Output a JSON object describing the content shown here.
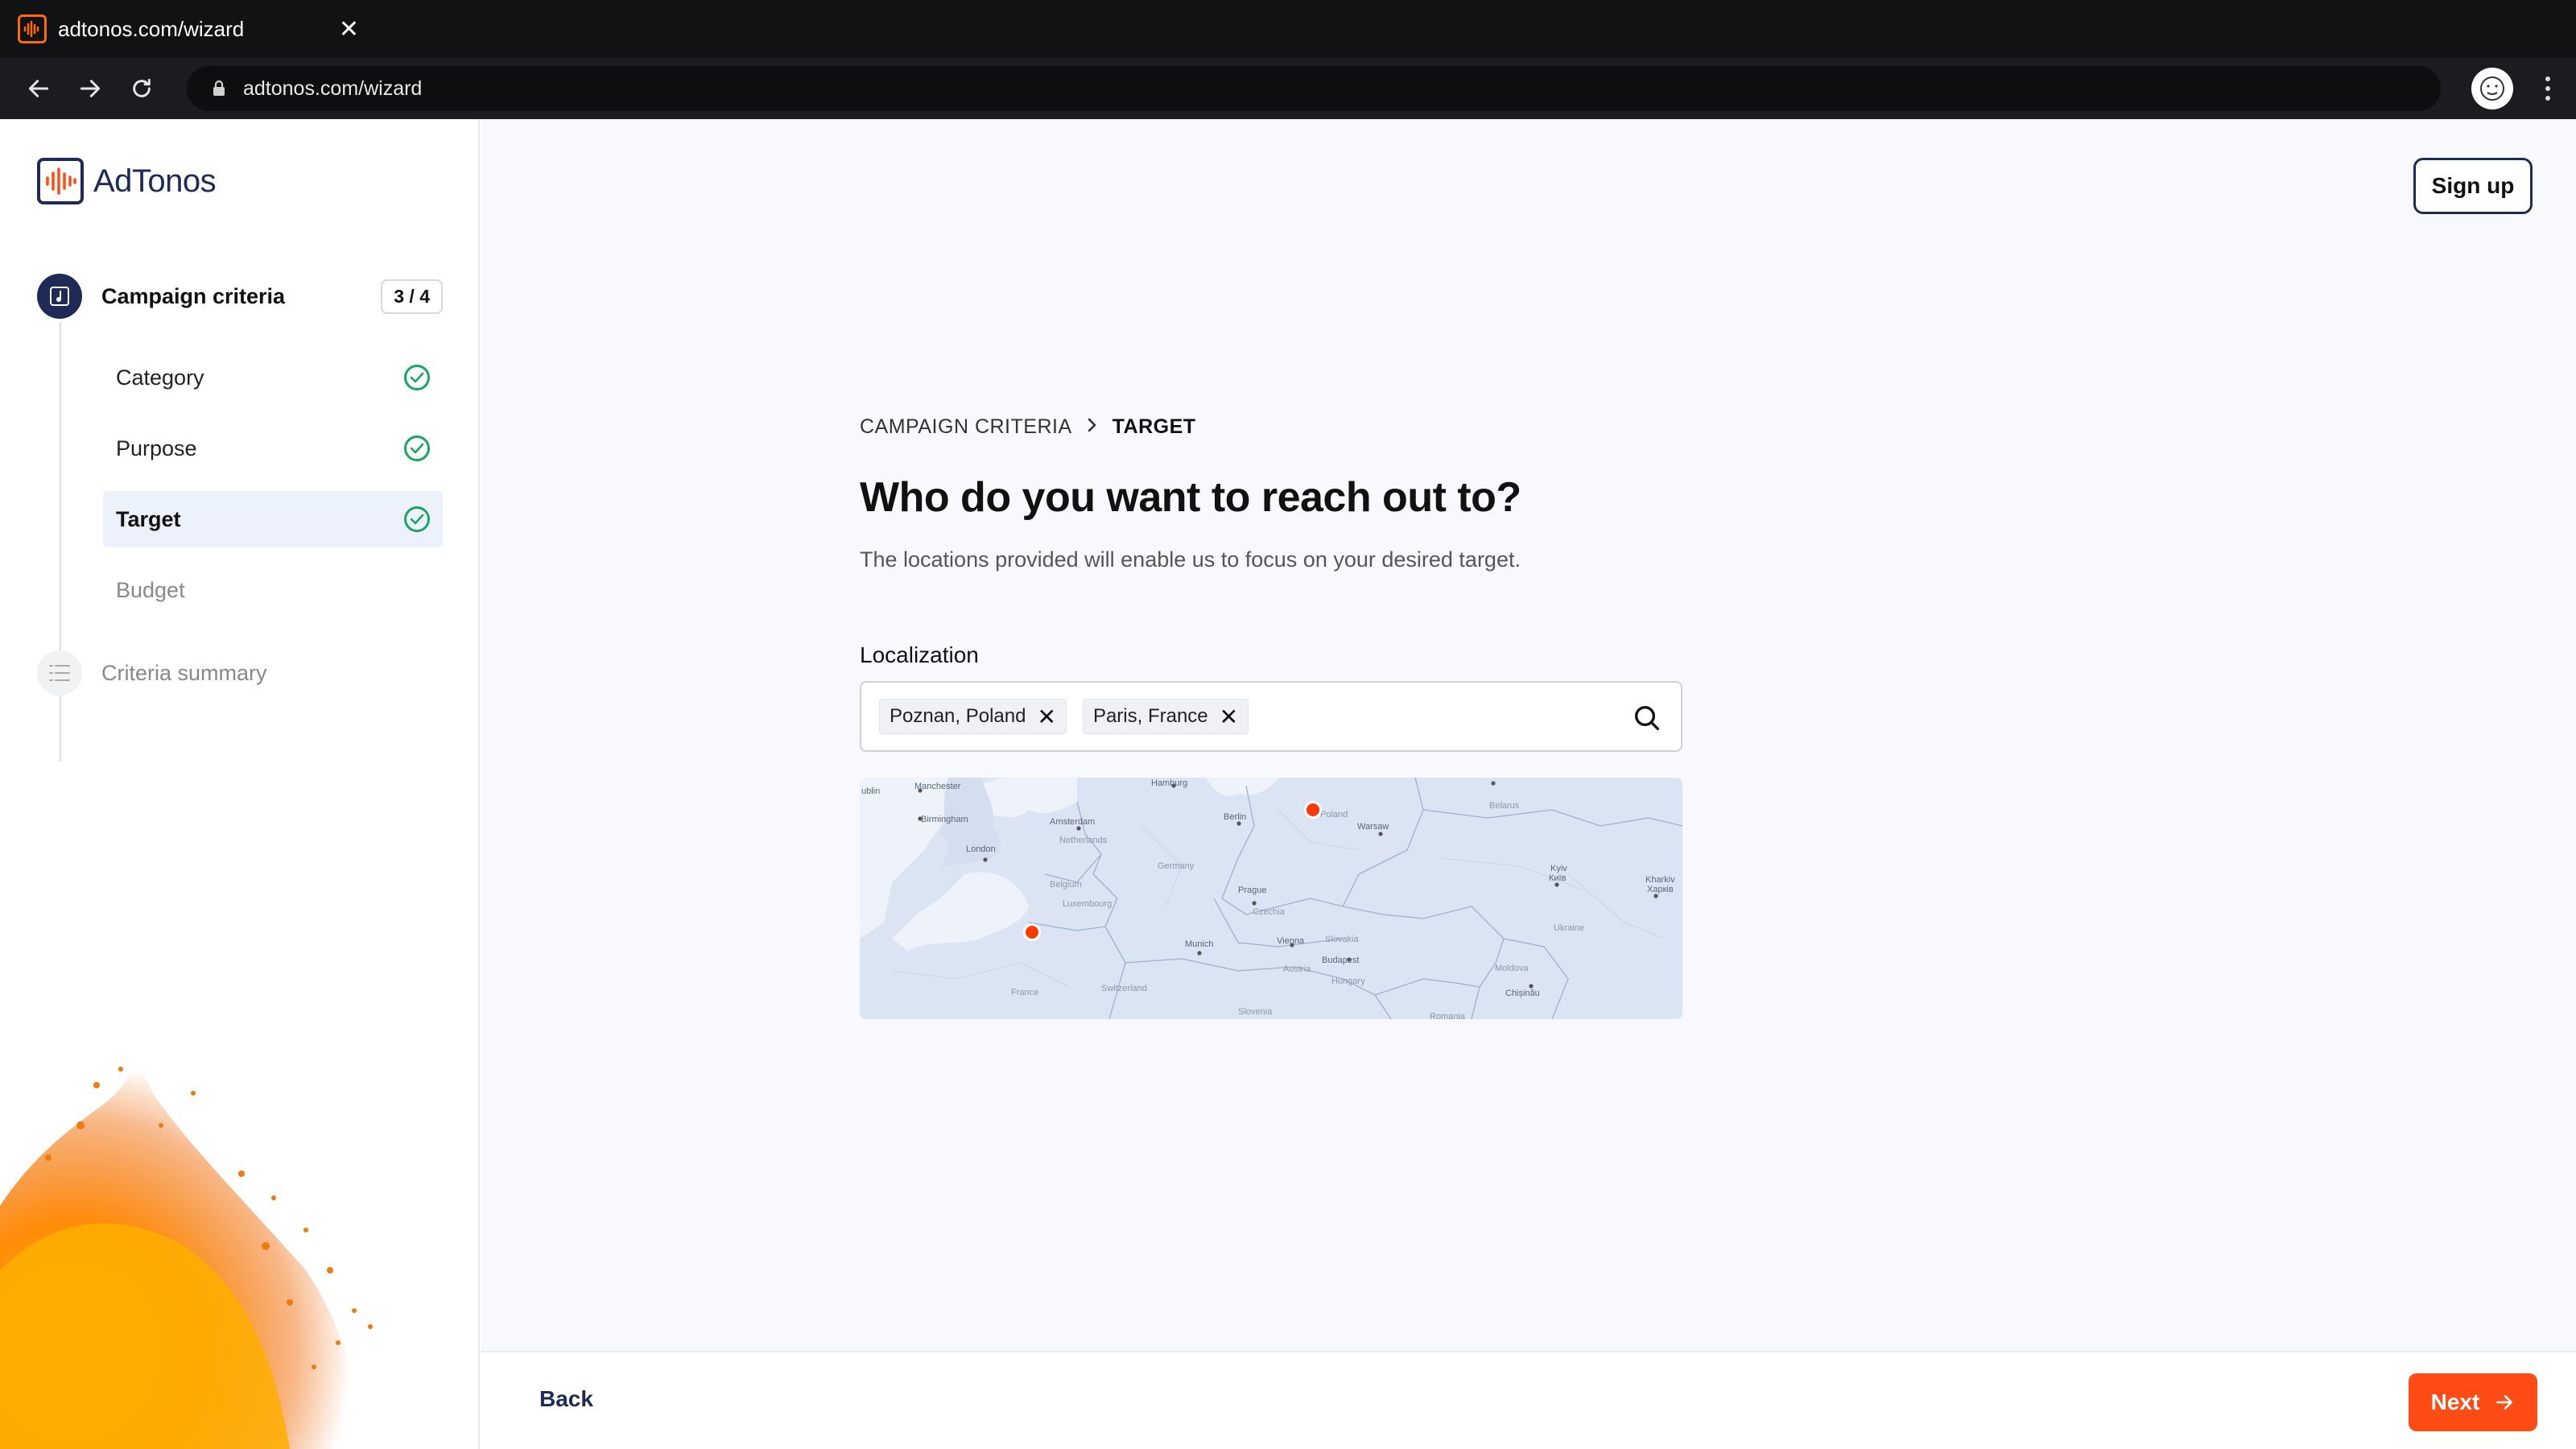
{
  "browser": {
    "tab_title": "adtonos.com/wizard",
    "url": "adtonos.com/wizard"
  },
  "brand": {
    "name": "AdTonos",
    "accent": "#ff4c14",
    "navy": "#1f2a57"
  },
  "sidebar": {
    "step_title": "Campaign criteria",
    "step_count": "3 / 4",
    "substeps": [
      {
        "label": "Category",
        "status": "complete"
      },
      {
        "label": "Purpose",
        "status": "complete"
      },
      {
        "label": "Target",
        "status": "complete",
        "active": true
      },
      {
        "label": "Budget",
        "status": "pending"
      }
    ],
    "summary_label": "Criteria summary"
  },
  "header": {
    "signup_label": "Sign up"
  },
  "main": {
    "breadcrumb": [
      "CAMPAIGN CRITERIA",
      "TARGET"
    ],
    "heading": "Who do you want to reach out to?",
    "subtitle": "The locations provided will enable us to focus on your desired target.",
    "field_label": "Localization",
    "chips": [
      "Poznan, Poland",
      "Paris, France"
    ]
  },
  "map": {
    "labels": [
      "ublin",
      "Manchester",
      "Hamburg",
      "Belarus",
      "Birmingham",
      "Amsterdam",
      "Berlin",
      "Poland",
      "Warsaw",
      "Netherlands",
      "London",
      "Germany",
      "Kyiv",
      "Київ",
      "Kharkiv",
      "Харків",
      "Belgium",
      "Prague",
      "Luxembourg",
      "Czechia",
      "Ukraine",
      "Slovakia",
      "Munich",
      "Vienna",
      "Austria",
      "Budapest",
      "Moldova",
      "Hungary",
      "Chișinău",
      "France",
      "Switzerland",
      "Slovenia",
      "Romania"
    ],
    "pins": [
      "Poznan",
      "Paris"
    ]
  },
  "footer": {
    "back_label": "Back",
    "next_label": "Next"
  }
}
